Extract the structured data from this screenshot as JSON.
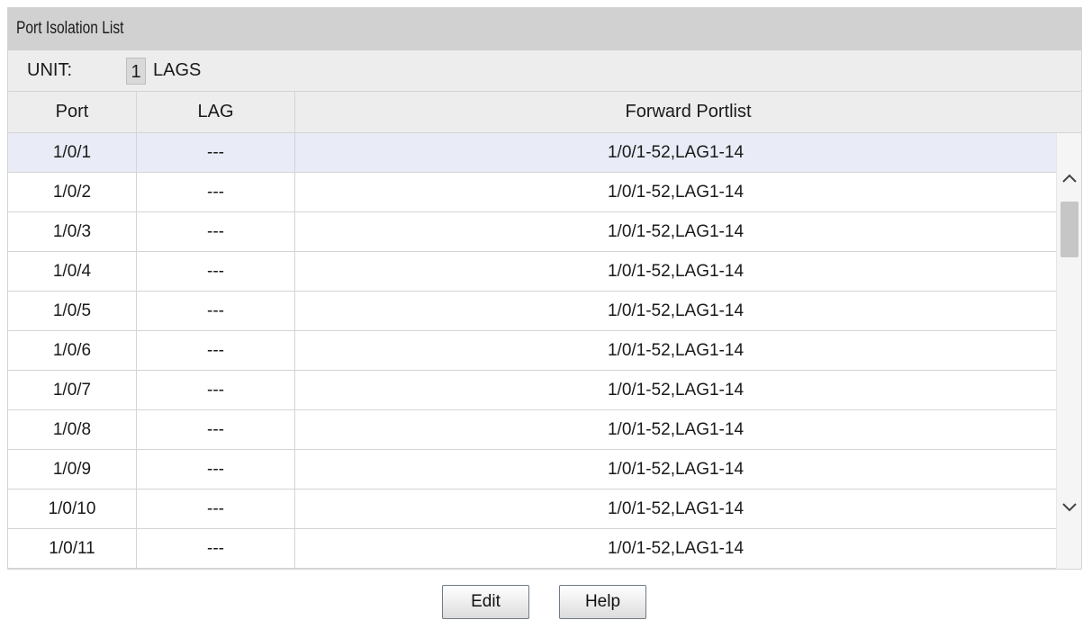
{
  "title": "Port Isolation List",
  "unit": {
    "label": "UNIT:",
    "value": "1",
    "lags": "LAGS"
  },
  "columns": [
    "Port",
    "LAG",
    "Forward Portlist"
  ],
  "rows": [
    {
      "port": "1/0/1",
      "lag": "---",
      "forward": "1/0/1-52,LAG1-14"
    },
    {
      "port": "1/0/2",
      "lag": "---",
      "forward": "1/0/1-52,LAG1-14"
    },
    {
      "port": "1/0/3",
      "lag": "---",
      "forward": "1/0/1-52,LAG1-14"
    },
    {
      "port": "1/0/4",
      "lag": "---",
      "forward": "1/0/1-52,LAG1-14"
    },
    {
      "port": "1/0/5",
      "lag": "---",
      "forward": "1/0/1-52,LAG1-14"
    },
    {
      "port": "1/0/6",
      "lag": "---",
      "forward": "1/0/1-52,LAG1-14"
    },
    {
      "port": "1/0/7",
      "lag": "---",
      "forward": "1/0/1-52,LAG1-14"
    },
    {
      "port": "1/0/8",
      "lag": "---",
      "forward": "1/0/1-52,LAG1-14"
    },
    {
      "port": "1/0/9",
      "lag": "---",
      "forward": "1/0/1-52,LAG1-14"
    },
    {
      "port": "1/0/10",
      "lag": "---",
      "forward": "1/0/1-52,LAG1-14"
    },
    {
      "port": "1/0/11",
      "lag": "---",
      "forward": "1/0/1-52,LAG1-14"
    }
  ],
  "buttons": {
    "edit": "Edit",
    "help": "Help"
  },
  "icons": {
    "scroll_up": "chevron-up-icon",
    "scroll_down": "chevron-down-icon"
  },
  "colors": {
    "title_bar": "#d1d1d1",
    "header_bg": "#ededed",
    "selected_row": "#e9ecf6"
  }
}
